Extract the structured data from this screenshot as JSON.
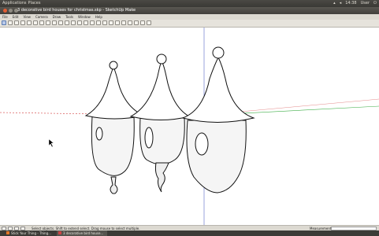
{
  "topbar": {
    "app_menu": "Applications",
    "places_menu": "Places",
    "time": "14:38",
    "user": "User"
  },
  "window": {
    "title": "3 decorative bird houses for christmas.skp - SketchUp Make"
  },
  "menu": [
    "File",
    "Edit",
    "View",
    "Camera",
    "Draw",
    "Tools",
    "Window",
    "Help"
  ],
  "status": {
    "message": "Select objects. Shift to extend select. Drag mouse to select multiple.",
    "measurements_label": "Measurements"
  },
  "taskbar": {
    "items": [
      "Stick Your Thing - Thing...",
      "3 decorative bird house..."
    ]
  },
  "colors": {
    "axis_red": "#d23a3a",
    "axis_green": "#3fae48",
    "axis_blue": "#5466c8"
  },
  "icons": [
    "select-icon",
    "eraser-icon",
    "pencil-icon",
    "arc-icon",
    "rectangle-icon",
    "circle-icon",
    "polygon-icon",
    "push-pull-icon",
    "move-icon",
    "rotate-icon",
    "scale-icon",
    "offset-icon",
    "tape-measure-icon",
    "dimension-icon",
    "protractor-icon",
    "text-icon",
    "axes-icon",
    "orbit-icon",
    "pan-icon",
    "zoom-icon",
    "zoom-extents-icon",
    "warehouse-icon",
    "extension-icon",
    "layout-icon"
  ]
}
